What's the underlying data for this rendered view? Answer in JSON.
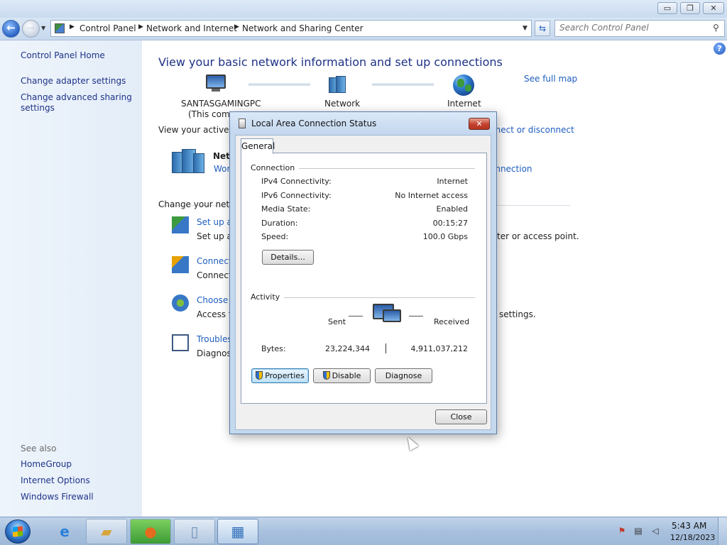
{
  "window": {
    "minimize_glyph": "▭",
    "maximize_glyph": "❐",
    "close_glyph": "✕"
  },
  "address_bar": {
    "crumbs": [
      "Control Panel",
      "Network and Internet",
      "Network and Sharing Center"
    ],
    "search_placeholder": "Search Control Panel"
  },
  "left_pane": {
    "links": [
      "Control Panel Home",
      "Change adapter settings",
      "Change advanced sharing",
      "settings"
    ],
    "see_also_label": "See also",
    "see_also_links": [
      "HomeGroup",
      "Internet Options",
      "Windows Firewall"
    ]
  },
  "main": {
    "title": "View your basic network information and set up connections",
    "see_full_map": "See full map",
    "map": {
      "computer_name": "SANTASGAMINGPC",
      "computer_sub": "(This comp",
      "network_label": "Network",
      "internet_label": "Internet"
    },
    "active_networks_label": "View your active net",
    "connect_or_disconnect": "nnect or disconnect",
    "active_network_name": "Net",
    "active_network_type": "Wor",
    "connection_link": "onnection",
    "change_settings_label": "Change your netw",
    "tasks": [
      {
        "title": "Set up a",
        "desc": "Set up a",
        "desc_tail": "ter or access point."
      },
      {
        "title": "Connect",
        "desc": "Connect",
        "desc_tail": ""
      },
      {
        "title": "Choose h",
        "desc": "Access fi",
        "desc_tail": "settings."
      },
      {
        "title": "Troubles",
        "desc": "Diagnose",
        "desc_tail": ""
      }
    ]
  },
  "dialog": {
    "title": "Local Area Connection Status",
    "tab": "General",
    "connection_group": "Connection",
    "rows": [
      {
        "label": "IPv4 Connectivity:",
        "value": "Internet"
      },
      {
        "label": "IPv6 Connectivity:",
        "value": "No Internet access"
      },
      {
        "label": "Media State:",
        "value": "Enabled"
      },
      {
        "label": "Duration:",
        "value": "00:15:27"
      },
      {
        "label": "Speed:",
        "value": "100.0 Gbps"
      }
    ],
    "details_button": "Details...",
    "activity_group": "Activity",
    "sent_label": "Sent",
    "received_label": "Received",
    "bytes_label": "Bytes:",
    "bytes_sent": "23,224,344",
    "bytes_received": "4,911,037,212",
    "properties_button": "Properties",
    "disable_button": "Disable",
    "diagnose_button": "Diagnose",
    "close_button": "Close"
  },
  "taskbar": {
    "time": "5:43 AM",
    "date": "12/18/2023"
  }
}
